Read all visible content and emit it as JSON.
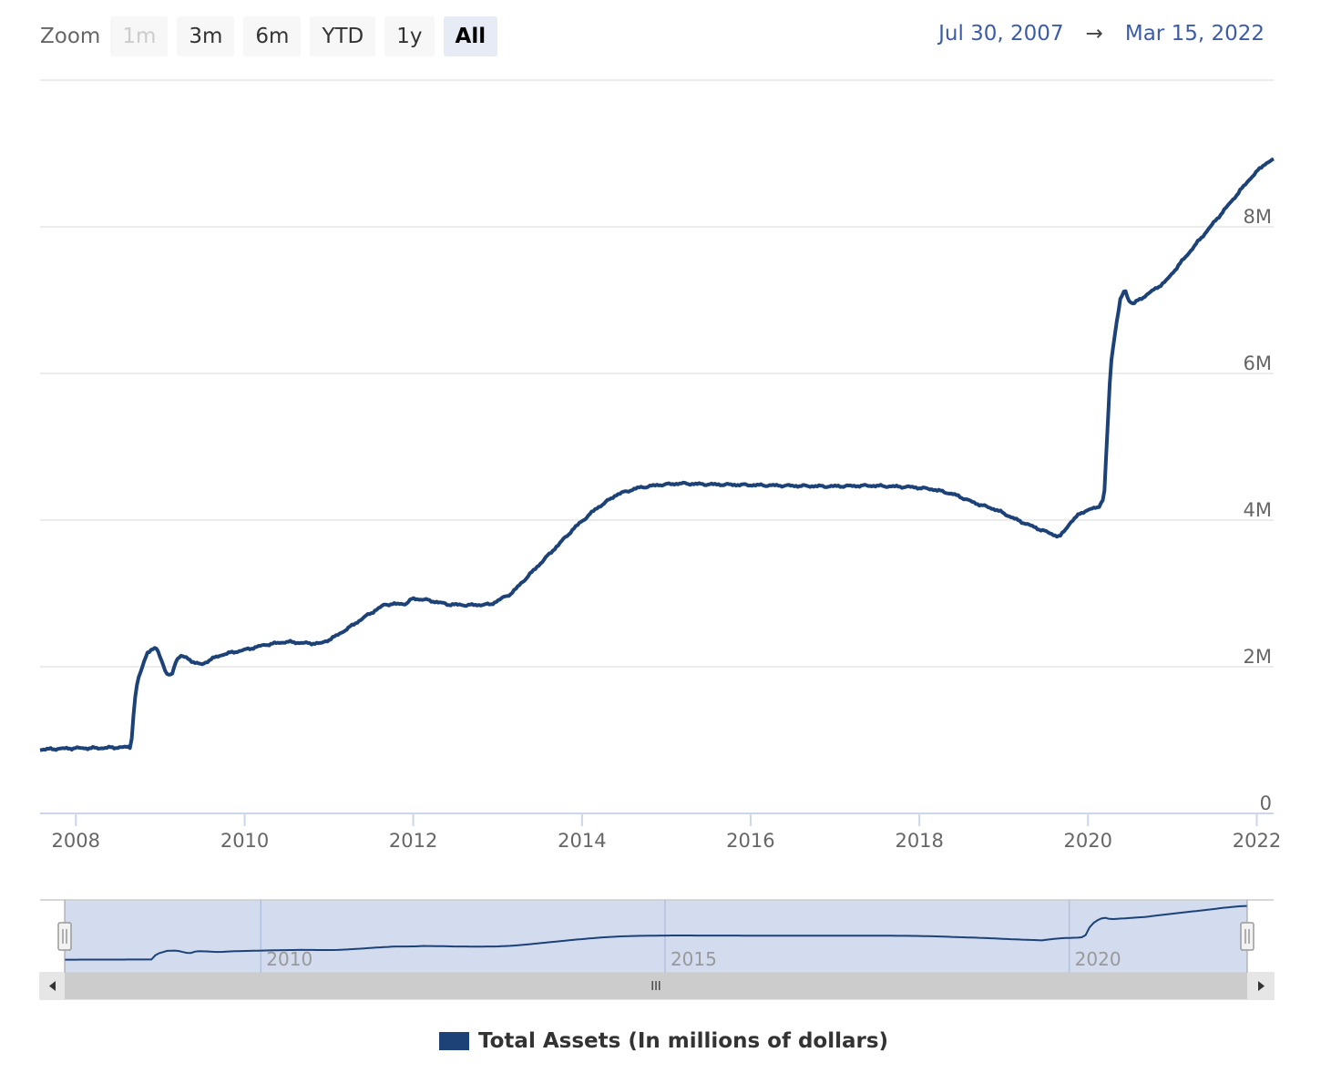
{
  "zoom": {
    "label": "Zoom",
    "buttons": [
      {
        "label": "1m",
        "state": "disabled"
      },
      {
        "label": "3m",
        "state": "normal"
      },
      {
        "label": "6m",
        "state": "normal"
      },
      {
        "label": "YTD",
        "state": "normal"
      },
      {
        "label": "1y",
        "state": "normal"
      },
      {
        "label": "All",
        "state": "selected"
      }
    ]
  },
  "range": {
    "from": "Jul 30, 2007",
    "arrow": "→",
    "to": "Mar 15, 2022"
  },
  "navigator": {
    "scroll_thumb_glyph": "III",
    "tick_labels": [
      "2010",
      "2015",
      "2020"
    ]
  },
  "colors": {
    "series": "#1c4278",
    "grid": "#e6e6e6",
    "navigator_mask": "#d3dbee",
    "scrollbar_track": "#cccccc"
  },
  "chart_data": {
    "type": "line",
    "title": "",
    "xlabel": "",
    "ylabel": "",
    "x_axis": {
      "type": "datetime",
      "range": [
        "2007-07-30",
        "2022-03-15"
      ],
      "tick_labels": [
        "2008",
        "2010",
        "2012",
        "2014",
        "2016",
        "2018",
        "2020",
        "2022"
      ]
    },
    "y_axis": {
      "range": [
        0,
        10000000
      ],
      "ticks": [
        0,
        2000000,
        4000000,
        6000000,
        8000000
      ],
      "tick_labels": [
        "0",
        "2M",
        "4M",
        "6M",
        "8M"
      ],
      "position": "right"
    },
    "grid": true,
    "legend_position": "bottom-center",
    "series": [
      {
        "name": "Total Assets (In millions of dollars)",
        "x": [
          "2007-07-30",
          "2007-10-01",
          "2008-01-01",
          "2008-04-01",
          "2008-07-01",
          "2008-08-27",
          "2008-09-10",
          "2008-09-24",
          "2008-10-15",
          "2008-11-05",
          "2008-11-26",
          "2008-12-17",
          "2009-01-07",
          "2009-01-28",
          "2009-02-18",
          "2009-03-11",
          "2009-04-01",
          "2009-05-06",
          "2009-06-03",
          "2009-07-01",
          "2009-08-05",
          "2009-10-01",
          "2010-01-01",
          "2010-04-01",
          "2010-07-01",
          "2010-10-01",
          "2010-12-01",
          "2011-02-01",
          "2011-04-01",
          "2011-06-15",
          "2011-09-01",
          "2011-12-01",
          "2011-12-30",
          "2012-03-01",
          "2012-06-01",
          "2012-09-01",
          "2012-12-01",
          "2013-03-01",
          "2013-06-01",
          "2013-09-01",
          "2013-12-01",
          "2014-03-01",
          "2014-06-01",
          "2014-09-01",
          "2014-12-01",
          "2015-03-01",
          "2015-06-01",
          "2015-12-01",
          "2016-06-01",
          "2016-12-01",
          "2017-06-01",
          "2017-12-01",
          "2018-03-01",
          "2018-06-01",
          "2018-09-01",
          "2018-12-01",
          "2019-03-01",
          "2019-06-01",
          "2019-09-01",
          "2019-10-15",
          "2019-12-01",
          "2020-01-15",
          "2020-02-15",
          "2020-03-11",
          "2020-03-25",
          "2020-04-08",
          "2020-04-29",
          "2020-05-20",
          "2020-06-10",
          "2020-06-24",
          "2020-07-15",
          "2020-09-01",
          "2020-12-01",
          "2021-03-01",
          "2021-06-01",
          "2021-09-01",
          "2021-12-01",
          "2022-02-01",
          "2022-03-15"
        ],
        "values": [
          870000,
          880000,
          890000,
          890000,
          900000,
          905000,
          1500000,
          1800000,
          2000000,
          2200000,
          2230000,
          2250000,
          2080000,
          1900000,
          1870000,
          2100000,
          2150000,
          2100000,
          2050000,
          2030000,
          2100000,
          2170000,
          2230000,
          2300000,
          2340000,
          2320000,
          2320000,
          2420000,
          2540000,
          2700000,
          2850000,
          2860000,
          2930000,
          2910000,
          2850000,
          2840000,
          2850000,
          3000000,
          3300000,
          3600000,
          3900000,
          4150000,
          4350000,
          4440000,
          4480000,
          4500000,
          4490000,
          4480000,
          4470000,
          4460000,
          4470000,
          4450000,
          4420000,
          4350000,
          4230000,
          4140000,
          4000000,
          3880000,
          3770000,
          3960000,
          4100000,
          4150000,
          4180000,
          4300000,
          5200000,
          6100000,
          6600000,
          7000000,
          7150000,
          7000000,
          6950000,
          7050000,
          7250000,
          7600000,
          7950000,
          8300000,
          8650000,
          8850000,
          8920000
        ]
      }
    ]
  }
}
